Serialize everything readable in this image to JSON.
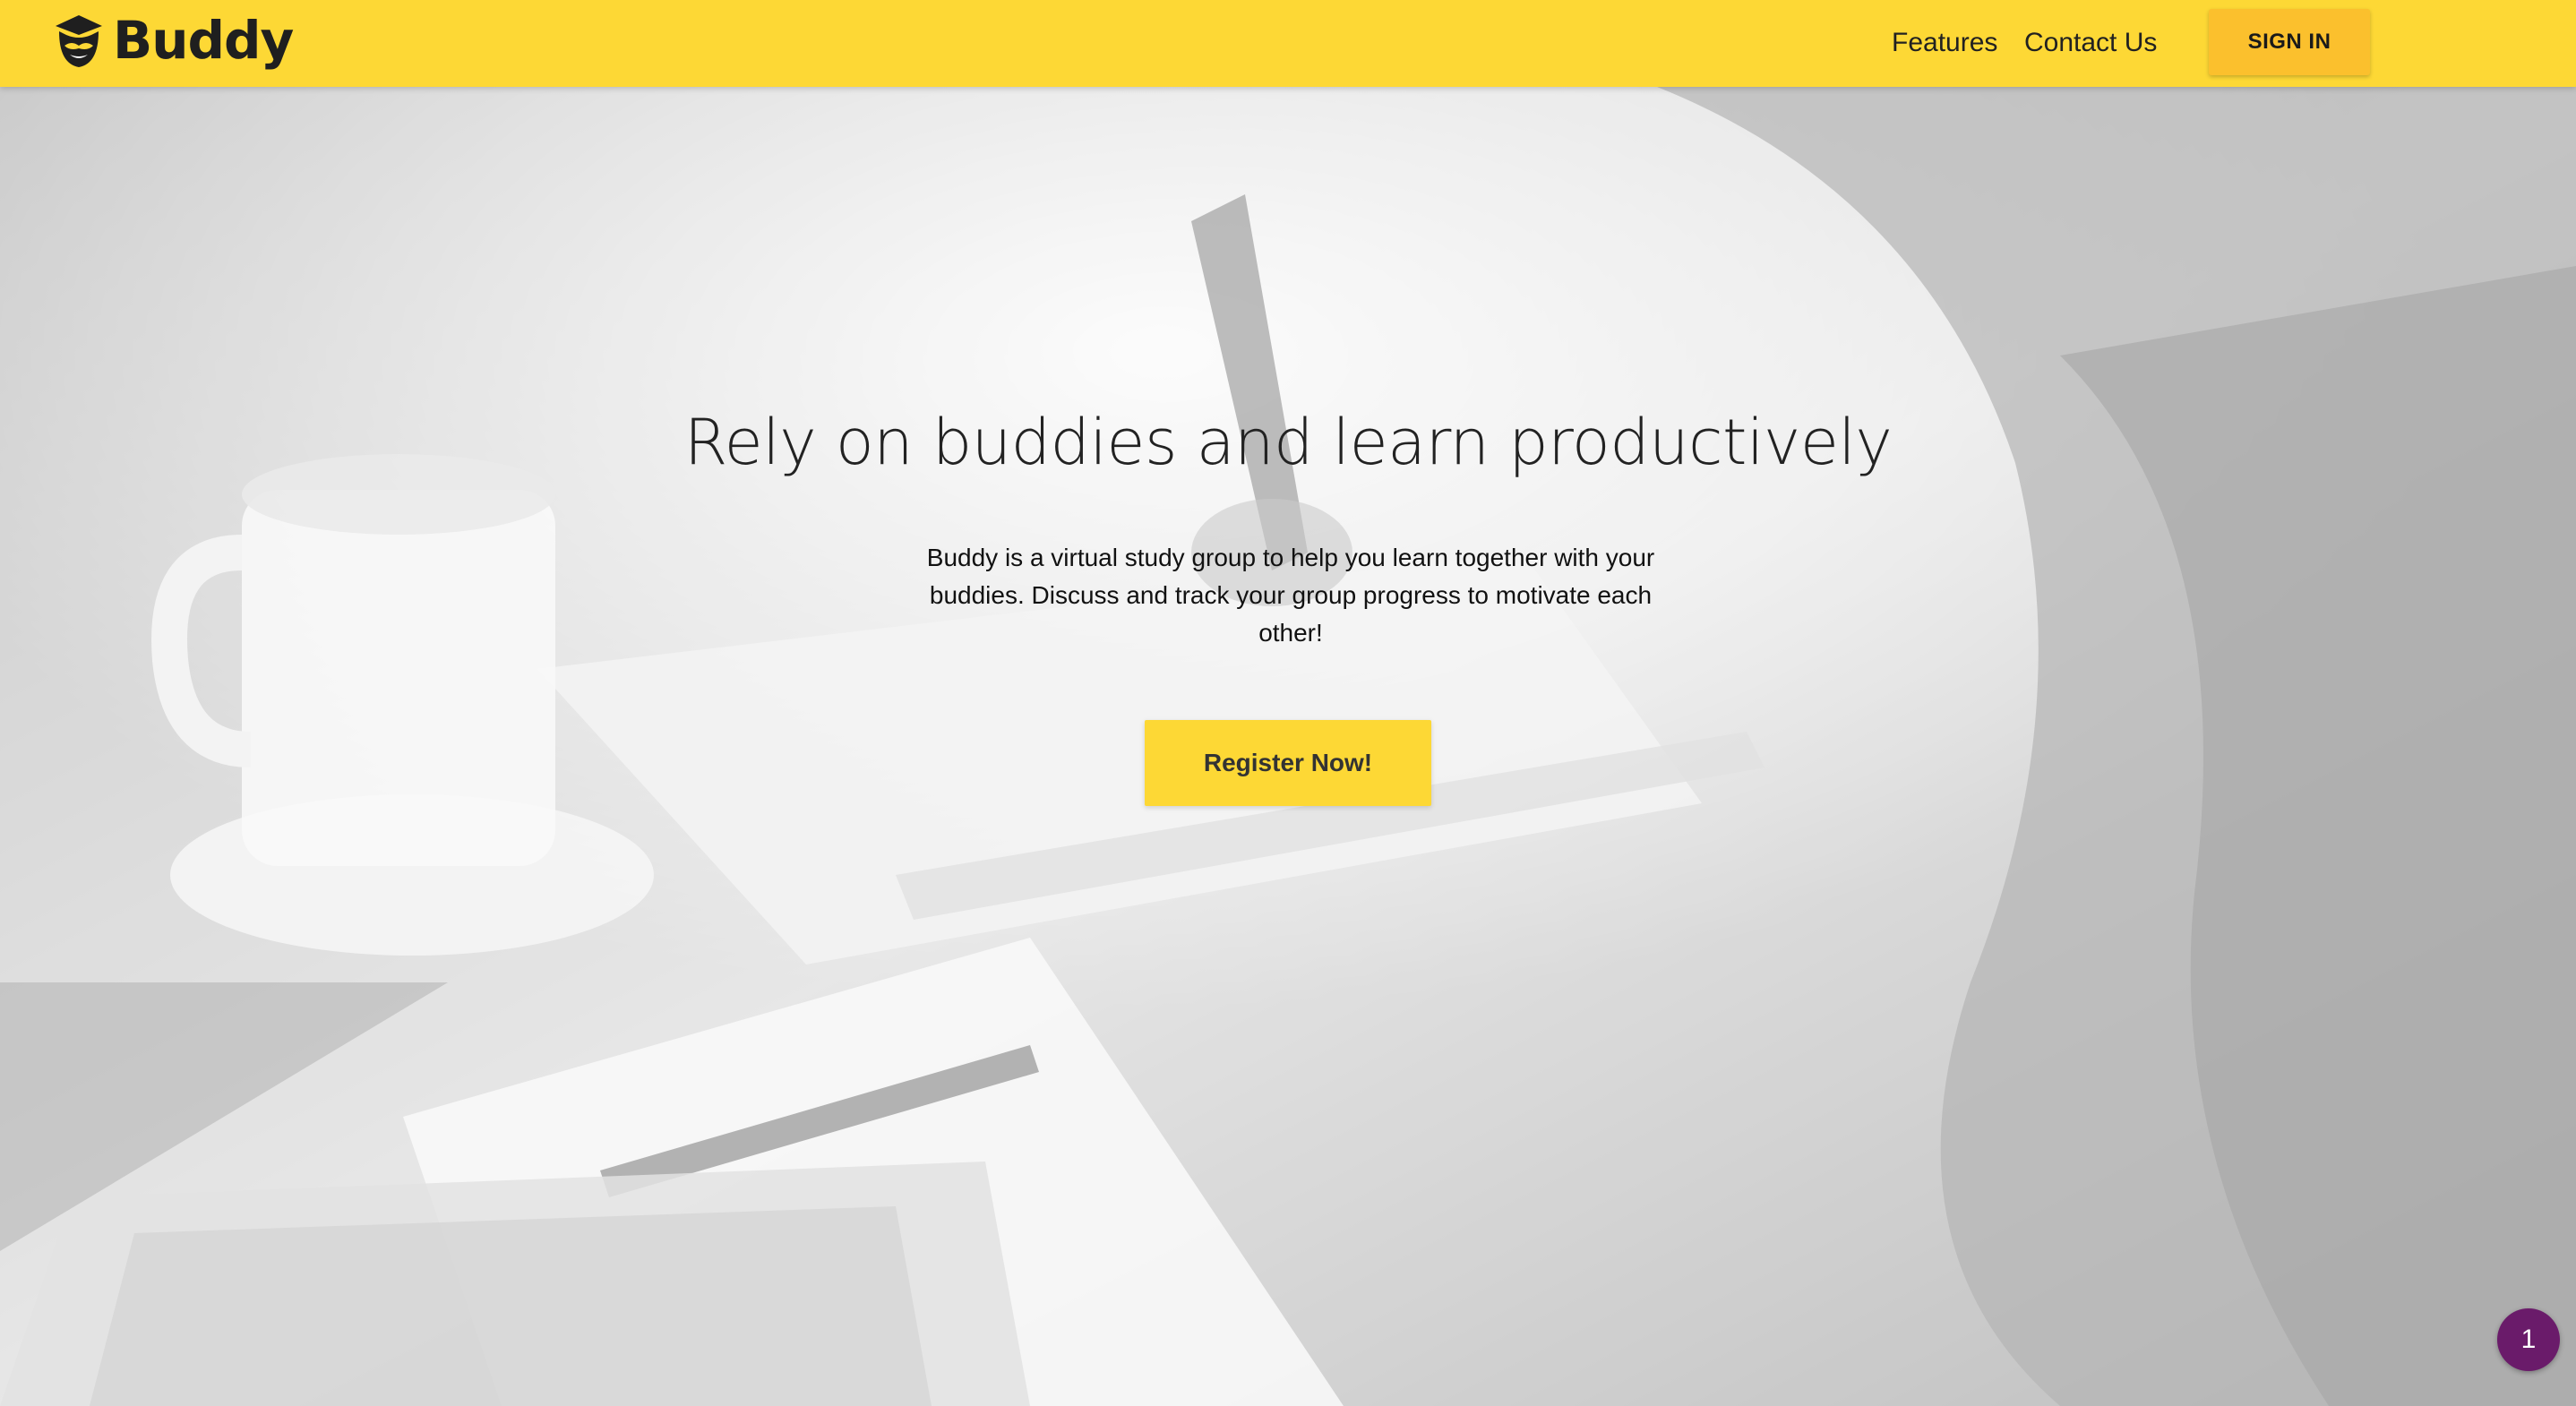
{
  "header": {
    "brand": "Buddy",
    "logo_icon": "mustache-face-icon",
    "nav": {
      "features": "Features",
      "contact": "Contact Us"
    },
    "signin_label": "SIGN IN"
  },
  "hero": {
    "title": "Rely on buddies and learn productively",
    "description": "Buddy is a virtual study group to help you learn together with your buddies. Discuss and track your group progress to motivate each other!",
    "register_label": "Register Now!",
    "background": "grayscale-study-desk-photo"
  },
  "notification": {
    "count": "1"
  },
  "colors": {
    "brand_yellow": "#fdd835",
    "button_yellow": "#fbc02d",
    "badge_purple": "#6a1b6a"
  }
}
